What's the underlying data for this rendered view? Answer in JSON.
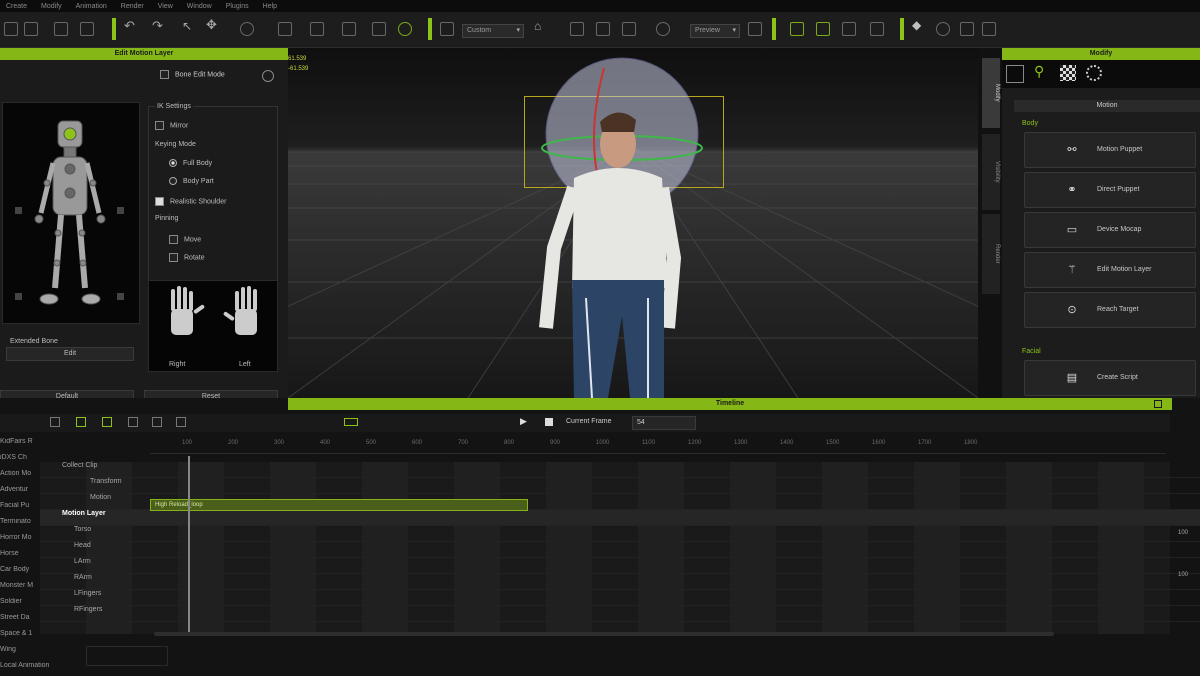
{
  "menu": [
    "Create",
    "Modify",
    "Animation",
    "Render",
    "View",
    "Window",
    "Plugins",
    "Help"
  ],
  "toolbar": {
    "preset_combo": "Custom",
    "render_combo": "Preview"
  },
  "edit_motion_layer": {
    "title": "Edit Motion Layer",
    "bone_edit_mode": "Bone Edit Mode",
    "ik_settings": "IK Settings",
    "mirror": "Mirror",
    "keying_mode": "Keying Mode",
    "full_body": "Full Body",
    "body_part": "Body Part",
    "realistic_shoulder": "Realistic Shoulder",
    "pinning": "Pinning",
    "move": "Move",
    "rotate": "Rotate",
    "hand_right": "Right",
    "hand_left": "Left",
    "extended_bone": "Extended Bone",
    "edit_button": "Edit",
    "default_button": "Default",
    "reset_button": "Reset"
  },
  "viewport": {
    "readout_1": "61.539",
    "readout_2": "-61.539"
  },
  "modify_panel": {
    "title": "Modify",
    "side_tabs": [
      "Modify",
      "Visibility",
      "Render"
    ],
    "section_title": "Motion",
    "body_label": "Body",
    "facial_label": "Facial",
    "buttons": [
      "Motion Puppet",
      "Direct Puppet",
      "Device Mocap",
      "Edit Motion Layer",
      "Reach Target"
    ],
    "facial_buttons": [
      "Create Script"
    ]
  },
  "timeline": {
    "title": "Timeline",
    "current_frame_label": "Current Frame",
    "current_frame_value": "54",
    "ruler": [
      "100",
      "200",
      "300",
      "400",
      "500",
      "600",
      "700",
      "800",
      "900",
      "1000",
      "1100",
      "1200",
      "1300",
      "1400",
      "1500",
      "1600",
      "1700",
      "1800"
    ],
    "project_items": [
      "KidFairs R",
      "iDXS Ch",
      "Action Mo",
      "Adventur",
      "Facial Pu",
      "Terminato",
      "Horror Mo",
      "Horse",
      "Car Body",
      "Monster M",
      "Soldier",
      "Street Da",
      "Space & 1",
      "Wing",
      "Local Animation"
    ],
    "tracks": [
      "Collect Clip",
      "Transform",
      "Motion",
      "Motion Layer",
      "Torso",
      "Head",
      "LArm",
      "RArm",
      "LFingers",
      "RFingers"
    ],
    "clip_name": "High Reload_loop",
    "right_values": [
      "100",
      "100"
    ]
  }
}
